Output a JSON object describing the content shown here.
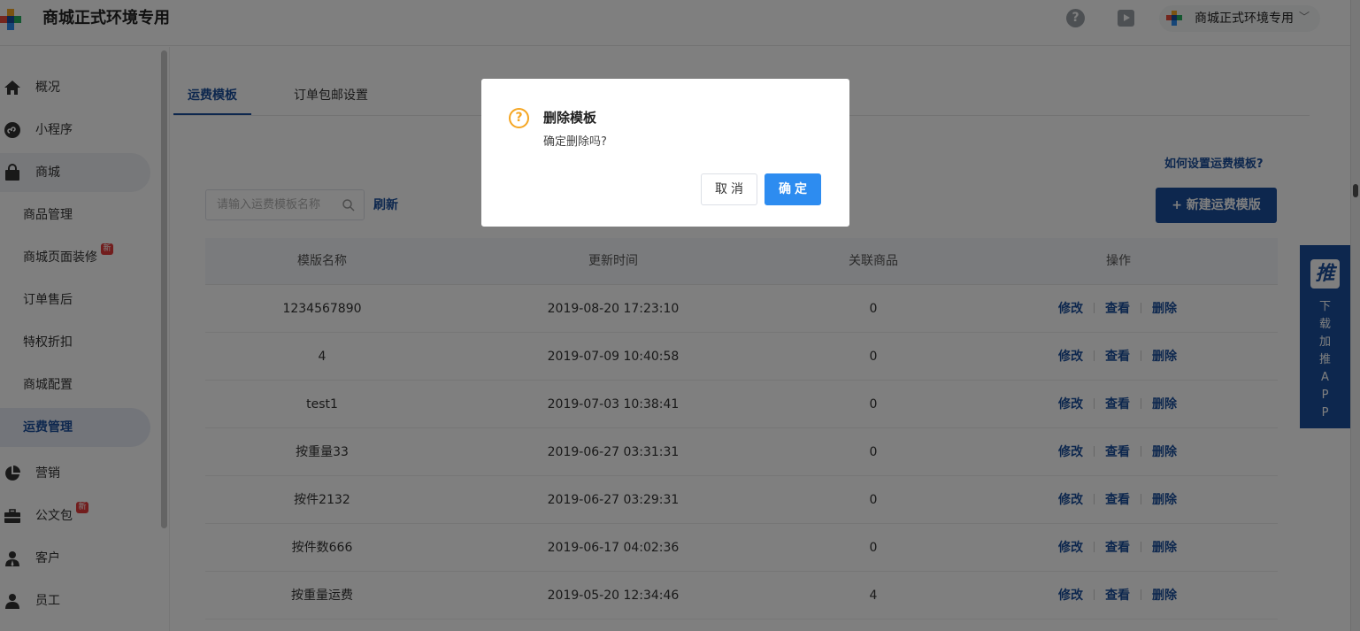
{
  "header": {
    "app_title": "商城正式环境专用",
    "help_glyph": "?",
    "store_name": "商城正式环境专用",
    "store_chevron": "﹀"
  },
  "sidebar": {
    "items": [
      {
        "label": "概况"
      },
      {
        "label": "小程序"
      },
      {
        "label": "商城"
      },
      {
        "label": "商品管理"
      },
      {
        "label": "商城页面装修",
        "badge": "新"
      },
      {
        "label": "订单售后"
      },
      {
        "label": "特权折扣"
      },
      {
        "label": "商城配置"
      },
      {
        "label": "运费管理"
      },
      {
        "label": "营销"
      },
      {
        "label": "公文包",
        "badge": "新"
      },
      {
        "label": "客户"
      },
      {
        "label": "员工"
      }
    ]
  },
  "main": {
    "tabs": [
      {
        "label": "运费模板"
      },
      {
        "label": "订单包邮设置"
      }
    ],
    "help_link": "如何设置运费模板?",
    "search": {
      "placeholder": "请输入运费模板名称",
      "value": ""
    },
    "refresh_label": "刷新",
    "new_button": "+ 新建运费模版",
    "table": {
      "columns": [
        "模版名称",
        "更新时间",
        "关联商品",
        "操作"
      ],
      "actions": [
        "修改",
        "查看",
        "删除"
      ],
      "rows": [
        {
          "name": "1234567890",
          "updated": "2019-08-20 17:23:10",
          "linked": "0"
        },
        {
          "name": "4",
          "updated": "2019-07-09 10:40:58",
          "linked": "0"
        },
        {
          "name": "test1",
          "updated": "2019-07-03 10:38:41",
          "linked": "0"
        },
        {
          "name": "按重量33",
          "updated": "2019-06-27 03:31:31",
          "linked": "0"
        },
        {
          "name": "按件2132",
          "updated": "2019-06-27 03:29:31",
          "linked": "0"
        },
        {
          "name": "按件数666",
          "updated": "2019-06-17 04:02:36",
          "linked": "0"
        },
        {
          "name": "按重量运费",
          "updated": "2019-05-20 12:34:46",
          "linked": "4"
        }
      ]
    }
  },
  "app_promo": {
    "logo_text": "推",
    "text": "下载加推APP"
  },
  "dialog": {
    "icon_glyph": "?",
    "title": "删除模板",
    "message": "确定删除吗?",
    "cancel_label": "取消",
    "ok_label": "确定"
  },
  "colors": {
    "primary": "#1b4f9c",
    "confirm": "#2d8cf0",
    "warning": "#f5a623",
    "badge": "#e43b3b"
  }
}
